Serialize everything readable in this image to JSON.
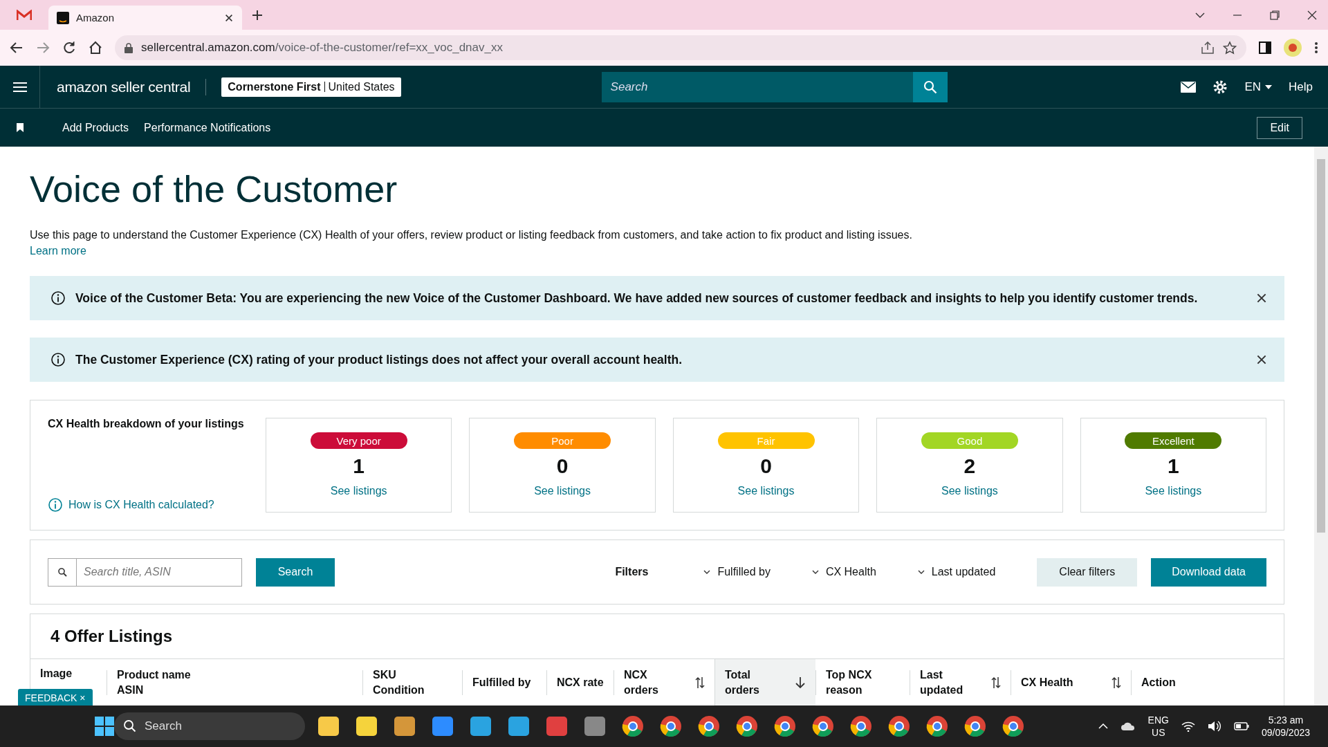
{
  "browser": {
    "tab_title": "Amazon",
    "url_host": "sellercentral.amazon.com",
    "url_path": "/voice-of-the-customer/ref=xx_voc_dnav_xx"
  },
  "header": {
    "logo": "amazon seller central",
    "store": "Cornerstone First",
    "region": "United States",
    "search_placeholder": "Search",
    "language": "EN",
    "help": "Help"
  },
  "subnav": {
    "links": [
      "Add Products",
      "Performance Notifications"
    ],
    "edit": "Edit"
  },
  "page": {
    "title": "Voice of the Customer",
    "description": "Use this page to understand the Customer Experience (CX) Health of your offers, review product or listing feedback from customers, and take action to fix product and listing issues.",
    "learn_more": "Learn more"
  },
  "banners": [
    {
      "text": "Voice of the Customer Beta: You are experiencing the new Voice of the Customer Dashboard. We have added new sources of customer feedback and insights to help you identify customer trends."
    },
    {
      "text": "The Customer Experience (CX) rating of your product listings does not affect your overall account health."
    }
  ],
  "cx_health": {
    "title": "CX Health breakdown of your listings",
    "help_link": "How is CX Health calculated?",
    "cards": [
      {
        "label": "Very poor",
        "color": "#cc0c39",
        "count": "1",
        "link": "See listings"
      },
      {
        "label": "Poor",
        "color": "#ff8c00",
        "count": "0",
        "link": "See listings"
      },
      {
        "label": "Fair",
        "color": "#ffc300",
        "count": "0",
        "link": "See listings"
      },
      {
        "label": "Good",
        "color": "#a2d624",
        "count": "2",
        "link": "See listings"
      },
      {
        "label": "Excellent",
        "color": "#507b00",
        "count": "1",
        "link": "See listings"
      }
    ]
  },
  "filters": {
    "search_placeholder": "Search title, ASIN",
    "search_button": "Search",
    "label": "Filters",
    "dropdowns": [
      "Fulfilled by",
      "CX Health",
      "Last updated"
    ],
    "clear": "Clear filters",
    "download": "Download data"
  },
  "listings": {
    "title": "4 Offer Listings",
    "columns": [
      {
        "lines": [
          "Image"
        ],
        "kind": "plain",
        "selected": false
      },
      {
        "lines": [
          "Product name",
          "ASIN"
        ],
        "kind": "plain",
        "selected": false
      },
      {
        "lines": [
          "SKU",
          "Condition"
        ],
        "kind": "plain",
        "selected": false
      },
      {
        "lines": [
          "Fulfilled by"
        ],
        "kind": "plain",
        "selected": false
      },
      {
        "lines": [
          "NCX rate"
        ],
        "kind": "plain",
        "selected": false
      },
      {
        "lines": [
          "NCX",
          "orders"
        ],
        "kind": "sortable",
        "selected": false
      },
      {
        "lines": [
          "Total",
          "orders"
        ],
        "kind": "sorted",
        "selected": true
      },
      {
        "lines": [
          "Top NCX",
          "reason"
        ],
        "kind": "plain",
        "selected": false
      },
      {
        "lines": [
          "Last",
          "updated"
        ],
        "kind": "sortable",
        "selected": false
      },
      {
        "lines": [
          "CX Health"
        ],
        "kind": "sortable",
        "selected": false
      },
      {
        "lines": [
          "Action"
        ],
        "kind": "plain",
        "selected": false
      }
    ]
  },
  "feedback": "FEEDBACK ×",
  "taskbar": {
    "search": "Search",
    "language": "ENG",
    "region": "US",
    "time": "5:23 am",
    "date": "09/09/2023"
  }
}
